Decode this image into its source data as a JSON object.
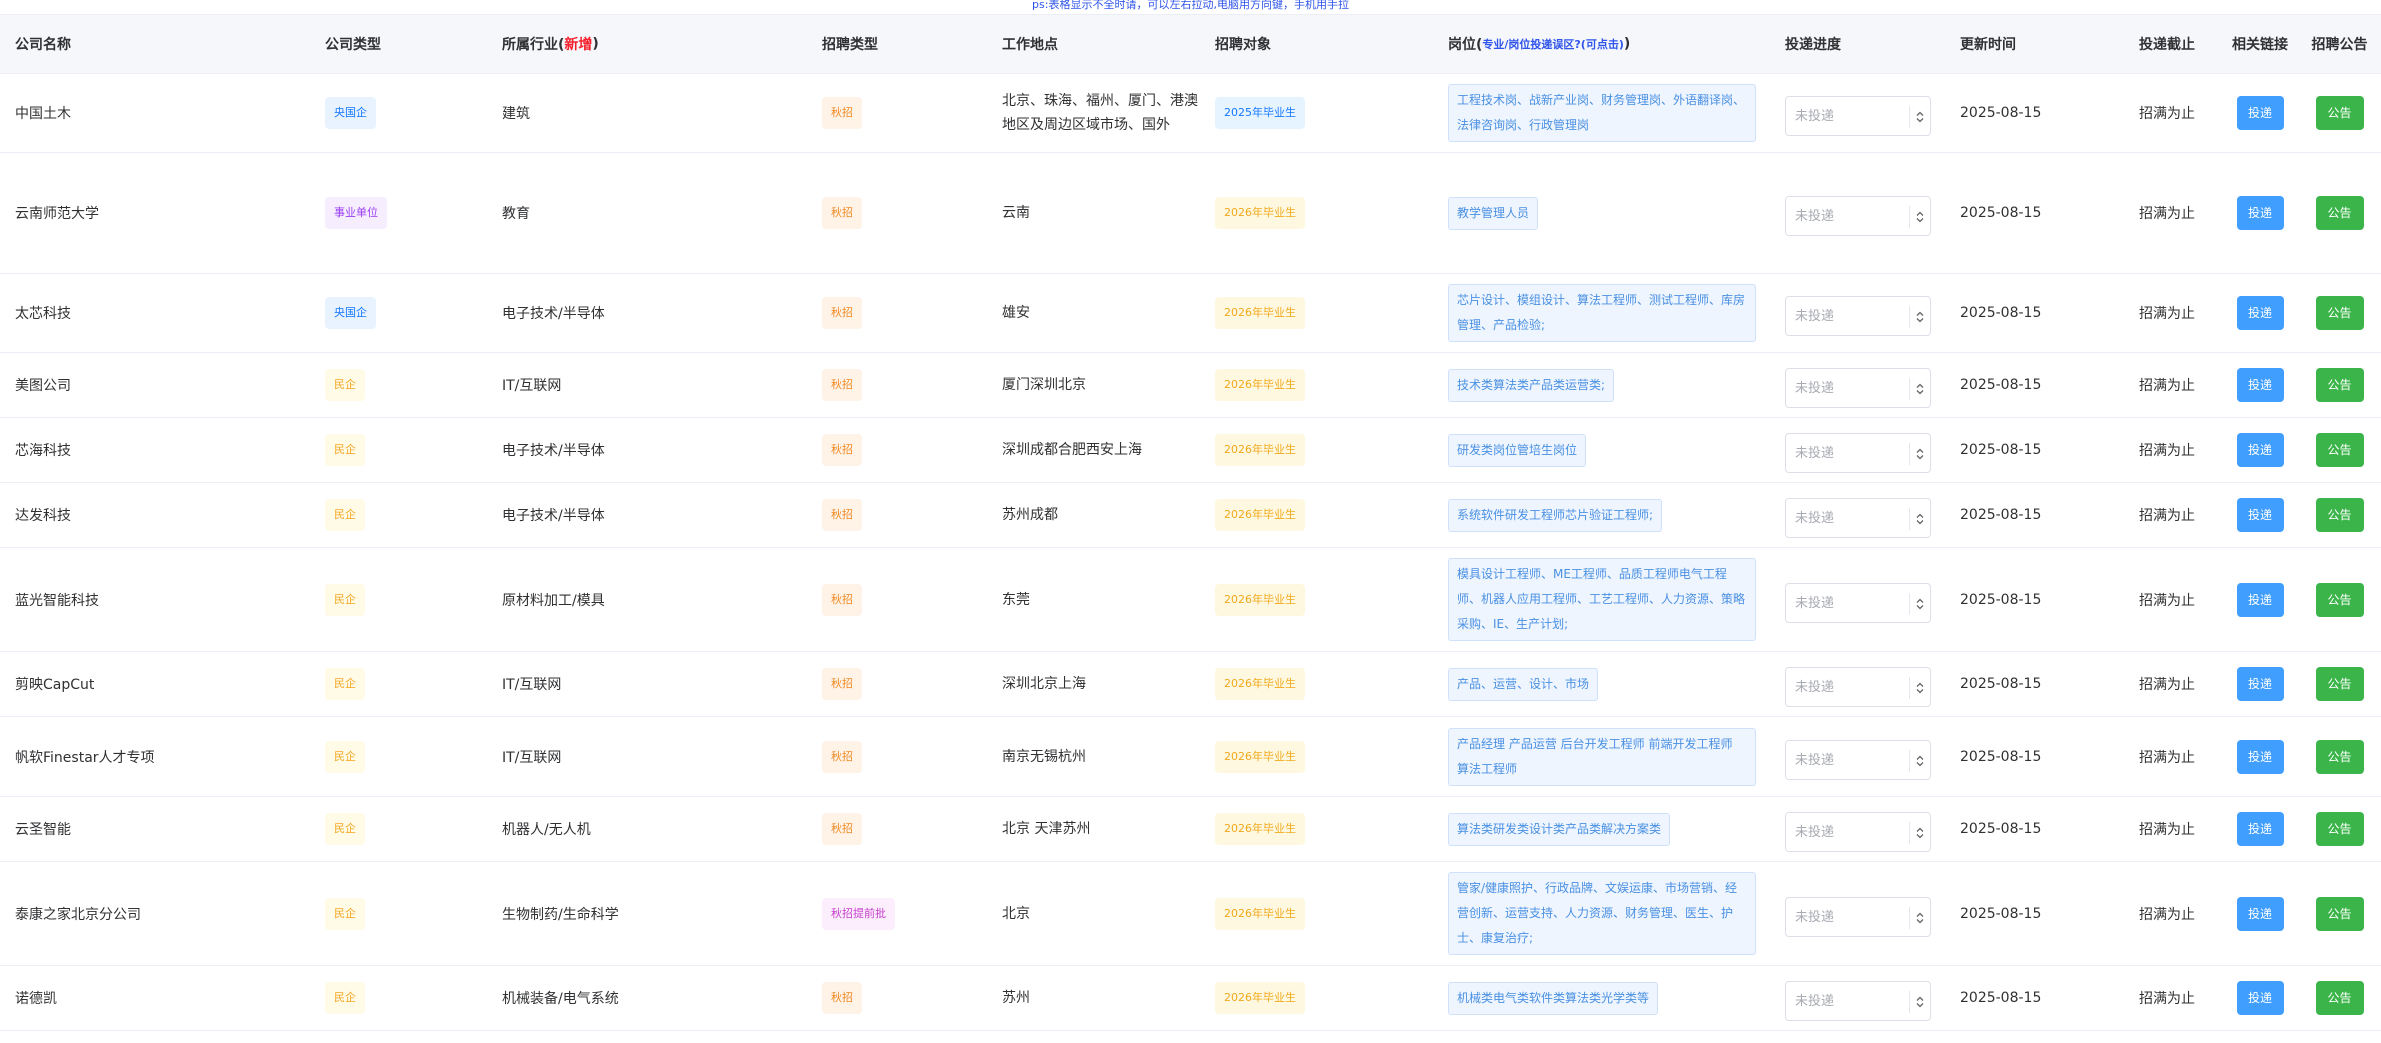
{
  "notice": "ps:表格显示不全时请，可以左右拉动,电脑用方向键，手机用手拉",
  "headers": {
    "company": "公司名称",
    "type": "公司类型",
    "industry_prefix": "所属行业(",
    "industry_new": "新增",
    "industry_suffix": ")",
    "recruit": "招聘类型",
    "location": "工作地点",
    "target": "招聘对象",
    "position_prefix": "岗位(",
    "position_link": "专业/岗位投递误区?(可点击)",
    "position_suffix": ")",
    "progress": "投递进度",
    "updated": "更新时间",
    "deadline": "投递截止",
    "link": "相关链接",
    "announcement": "招聘公告"
  },
  "labels": {
    "progress_placeholder": "未投递",
    "apply_button": "投递",
    "notice_button": "公告"
  },
  "colors": {
    "header_bg": "#f5f7fa",
    "apply_button": "#409eff",
    "notice_button": "#3bb54a",
    "highlight_red": "#f5222d",
    "highlight_blue": "#2f54eb"
  },
  "rows": [
    {
      "company": "中国土木",
      "type": "央国企",
      "industry": "建筑",
      "recruit": "秋招",
      "location": "北京、珠海、福州、厦门、港澳地区及周边区域市场、国外",
      "target": "2025年毕业生",
      "positions": "工程技术岗、战新产业岗、财务管理岗、外语翻译岗、法律咨询岗、行政管理岗",
      "updated": "2025-08-15",
      "deadline": "招满为止"
    },
    {
      "company": "云南师范大学",
      "type": "事业单位",
      "industry": "教育",
      "recruit": "秋招",
      "location": "云南",
      "target": "2026年毕业生",
      "positions": "教学管理人员",
      "updated": "2025-08-15",
      "deadline": "招满为止"
    },
    {
      "company": "太芯科技",
      "type": "央国企",
      "industry": "电子技术/半导体",
      "recruit": "秋招",
      "location": "雄安",
      "target": "2026年毕业生",
      "positions": "芯片设计、模组设计、算法工程师、测试工程师、库房管理、产品检验;",
      "updated": "2025-08-15",
      "deadline": "招满为止"
    },
    {
      "company": "美图公司",
      "type": "民企",
      "industry": "IT/互联网",
      "recruit": "秋招",
      "location": "厦门深圳北京",
      "target": "2026年毕业生",
      "positions": "技术类算法类产品类运营类;",
      "updated": "2025-08-15",
      "deadline": "招满为止"
    },
    {
      "company": "芯海科技",
      "type": "民企",
      "industry": "电子技术/半导体",
      "recruit": "秋招",
      "location": "深圳成都合肥西安上海",
      "target": "2026年毕业生",
      "positions": "研发类岗位管培生岗位",
      "updated": "2025-08-15",
      "deadline": "招满为止"
    },
    {
      "company": "达发科技",
      "type": "民企",
      "industry": "电子技术/半导体",
      "recruit": "秋招",
      "location": "苏州成都",
      "target": "2026年毕业生",
      "positions": "系统软件研发工程师芯片验证工程师;",
      "updated": "2025-08-15",
      "deadline": "招满为止"
    },
    {
      "company": "蓝光智能科技",
      "type": "民企",
      "industry": "原材料加工/模具",
      "recruit": "秋招",
      "location": "东莞",
      "target": "2026年毕业生",
      "positions": "模具设计工程师、ME工程师、品质工程师电气工程师、机器人应用工程师、工艺工程师、人力资源、策略采购、IE、生产计划;",
      "updated": "2025-08-15",
      "deadline": "招满为止"
    },
    {
      "company": "剪映CapCut",
      "type": "民企",
      "industry": "IT/互联网",
      "recruit": "秋招",
      "location": "深圳北京上海",
      "target": "2026年毕业生",
      "positions": "产品、运营、设计、市场",
      "updated": "2025-08-15",
      "deadline": "招满为止"
    },
    {
      "company": "帆软Finestar人才专项",
      "type": "民企",
      "industry": "IT/互联网",
      "recruit": "秋招",
      "location": "南京无锡杭州",
      "target": "2026年毕业生",
      "positions": "产品经理 产品运营 后台开发工程师 前端开发工程师 算法工程师",
      "updated": "2025-08-15",
      "deadline": "招满为止"
    },
    {
      "company": "云圣智能",
      "type": "民企",
      "industry": "机器人/无人机",
      "recruit": "秋招",
      "location": "北京 天津苏州",
      "target": "2026年毕业生",
      "positions": "算法类研发类设计类产品类解决方案类",
      "updated": "2025-08-15",
      "deadline": "招满为止"
    },
    {
      "company": "泰康之家北京分公司",
      "type": "民企",
      "industry": "生物制药/生命科学",
      "recruit": "秋招提前批",
      "location": "北京",
      "target": "2026年毕业生",
      "positions": "管家/健康照护、行政品牌、文娱运康、市场营销、经营创新、运营支持、人力资源、财务管理、医生、护士、康复治疗;",
      "updated": "2025-08-15",
      "deadline": "招满为止"
    },
    {
      "company": "诺德凯",
      "type": "民企",
      "industry": "机械装备/电气系统",
      "recruit": "秋招",
      "location": "苏州",
      "target": "2026年毕业生",
      "positions": "机械类电气类软件类算法类光学类等",
      "updated": "2025-08-15",
      "deadline": "招满为止"
    }
  ]
}
